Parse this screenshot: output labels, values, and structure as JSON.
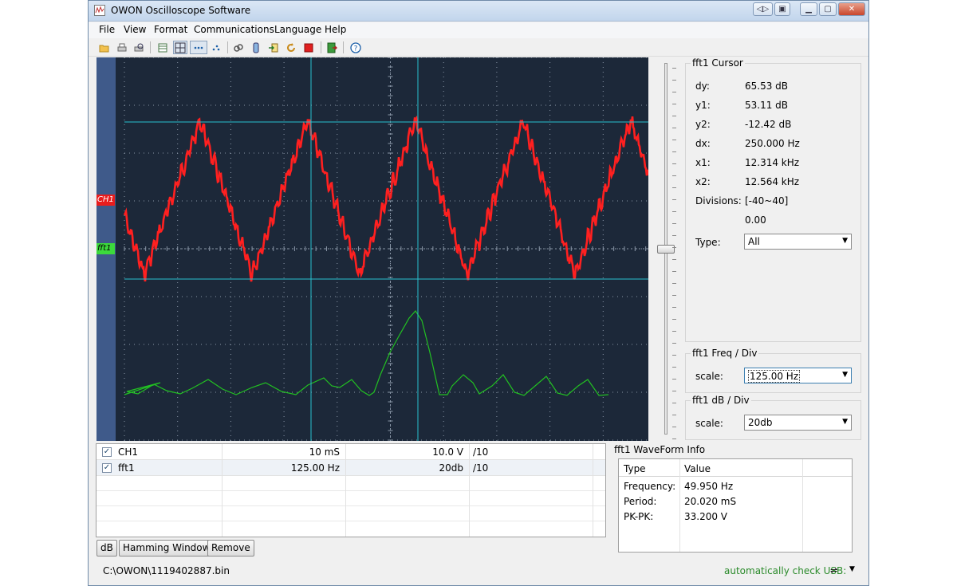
{
  "window": {
    "title": "OWON Oscilloscope Software"
  },
  "menu": [
    "File",
    "View",
    "Format",
    "Communications",
    "Language",
    "Help"
  ],
  "toolbar_icons": [
    "open-folder-icon",
    "print-icon",
    "print-preview-icon",
    "table-icon",
    "grid-icon",
    "dots-icon",
    "scatter-icon",
    "link-icon",
    "battery-icon",
    "export-icon",
    "refresh-icon",
    "stop-icon",
    "save-icon",
    "help-icon"
  ],
  "scope": {
    "ch1_marker": "CH1",
    "fft_marker": "fft1",
    "colors": {
      "background": "#1c2839",
      "grid": "#8a97a8",
      "ch1": "#ff2020",
      "fft": "#22c022",
      "cursor": "#29c0d0"
    }
  },
  "cursor_panel": {
    "title": "fft1 Cursor",
    "rows": [
      {
        "label": "dy:",
        "value": "65.53 dB"
      },
      {
        "label": "y1:",
        "value": "53.11 dB"
      },
      {
        "label": "y2:",
        "value": "-12.42 dB"
      },
      {
        "label": "dx:",
        "value": "250.000 Hz"
      },
      {
        "label": "x1:",
        "value": "12.314 kHz"
      },
      {
        "label": "x2:",
        "value": "12.564 kHz"
      },
      {
        "label": "Divisions:",
        "value": "[-40~40]"
      },
      {
        "label": "",
        "value": "0.00"
      }
    ],
    "type_label": "Type:",
    "type_value": "All"
  },
  "freq_panel": {
    "title": "fft1 Freq / Div",
    "scale_label": "scale:",
    "scale_value": "125.00 Hz"
  },
  "db_panel": {
    "title": "fft1 dB / Div",
    "scale_label": "scale:",
    "scale_value": "20db"
  },
  "channels": [
    {
      "checked": "✓",
      "name": "CH1",
      "timebase": "10 mS",
      "volts": "10.0 V",
      "probe": "/10"
    },
    {
      "checked": "✓",
      "name": "fft1",
      "timebase": "125.00 Hz",
      "volts": "20db",
      "probe": "/10"
    }
  ],
  "buttons": {
    "db": "dB",
    "window": "Hamming Window",
    "remove": "Remove"
  },
  "waveform_info": {
    "title": "fft1 WaveForm Info",
    "headers": [
      "Type",
      "Value"
    ],
    "rows": [
      {
        "type": "Frequency:",
        "value": "49.950 Hz"
      },
      {
        "type": "Period:",
        "value": "20.020 mS"
      },
      {
        "type": "PK-PK:",
        "value": "33.200 V"
      }
    ]
  },
  "status": {
    "path": "C:\\OWON\\1119402887.bin",
    "usb": "automatically check USB:"
  }
}
